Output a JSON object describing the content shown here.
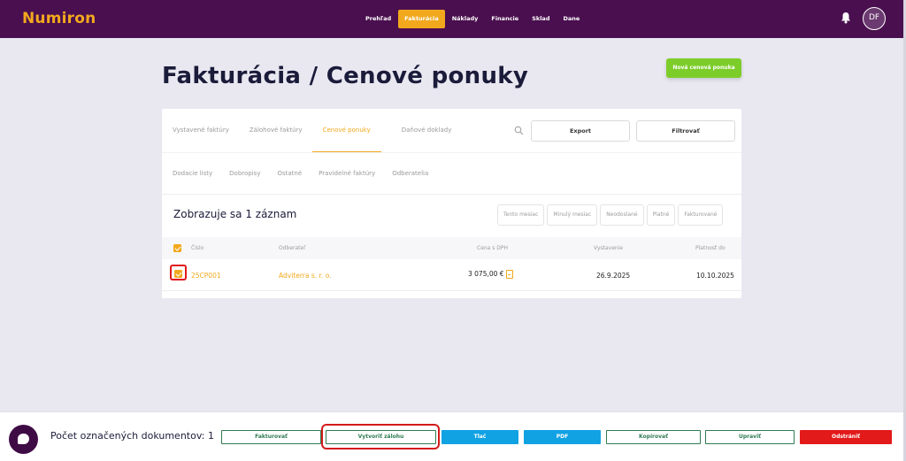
{
  "app": {
    "name": "Numiron"
  },
  "nav": {
    "items": [
      "Prehľad",
      "Fakturácia",
      "Náklady",
      "Financie",
      "Sklad",
      "Dane"
    ],
    "active": "Fakturácia"
  },
  "user": {
    "initials": "DF"
  },
  "page": {
    "title": "Fakturácia / Cenové ponuky",
    "new_button": "Nová cenová ponuka"
  },
  "tabs": {
    "row1": [
      "Vystavené faktúry",
      "Zálohové faktúry",
      "Cenové ponuky",
      "Daňové doklady"
    ],
    "active": "Cenové ponuky",
    "row2": [
      "Dodacie listy",
      "Dobropisy",
      "Ostatné",
      "Pravidelné faktúry",
      "Odberatelia"
    ]
  },
  "toolbar": {
    "export": "Export",
    "filter": "Filtrovať"
  },
  "records": {
    "label": "Zobrazuje sa 1 záznam"
  },
  "filters": [
    "Tento mesiac",
    "Minulý mesiac",
    "Neodoslané",
    "Platné",
    "Fakturované"
  ],
  "table": {
    "headers": {
      "number": "Číslo",
      "customer": "Odberateľ",
      "price": "Cena s DPH",
      "issued": "Vystavenie",
      "valid": "Platnosť do"
    },
    "rows": [
      {
        "number": "25CP001",
        "customer": "Adviterra s. r. o.",
        "price": "3 075,00 €",
        "issued": "26.9.2025",
        "valid": "10.10.2025"
      }
    ]
  },
  "bottom": {
    "selected_label": "Počet označených dokumentov: 1",
    "buttons": {
      "invoice": "Fakturovať",
      "deposit": "Vytvoriť zálohu",
      "print": "Tlač",
      "pdf": "PDF",
      "copy": "Kopírovať",
      "edit": "Upraviť",
      "delete": "Odstrániť"
    }
  },
  "colors": {
    "brand": "#4a0f4f",
    "accent": "#f2a81d",
    "primary_action": "#7ccd2a",
    "blue": "#11a2e3",
    "danger": "#e21a1a",
    "outline_green": "#2f7c52"
  }
}
